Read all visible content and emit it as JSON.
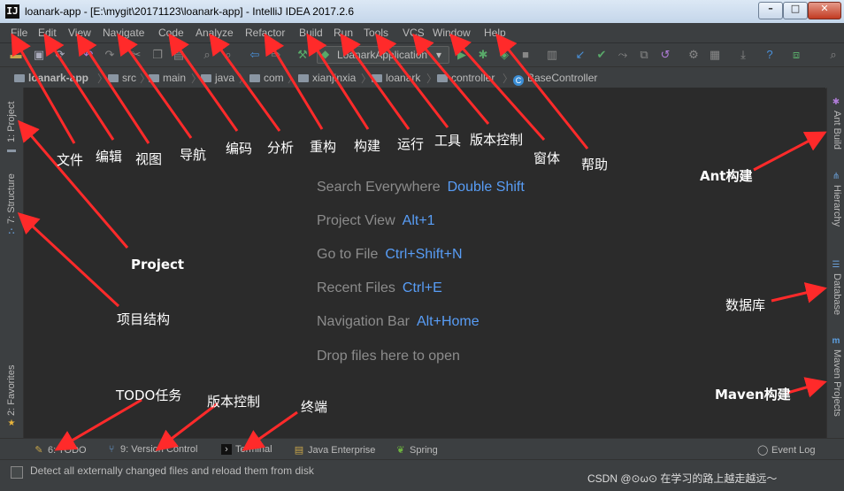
{
  "window": {
    "icon": "IJ",
    "title": "loanark-app - [E:\\mygit\\20171123\\loanark-app] - IntelliJ IDEA 2017.2.6",
    "min": "–",
    "max": "□",
    "close": "✕"
  },
  "menu": [
    "File",
    "Edit",
    "View",
    "Navigate",
    "Code",
    "Analyze",
    "Refactor",
    "Build",
    "Run",
    "Tools",
    "VCS",
    "Window",
    "Help"
  ],
  "toolbar": {
    "run_config": "LoanarkApplication"
  },
  "breadcrumb": [
    "loanark-app",
    "src",
    "main",
    "java",
    "com",
    "xianjinxia",
    "loanark",
    "controller",
    "BaseController"
  ],
  "left_tabs": {
    "project": "1: Project",
    "structure": "7: Structure",
    "favorites": "2: Favorites"
  },
  "right_tabs": {
    "ant": "Ant Build",
    "hierarchy": "Hierarchy",
    "database": "Database",
    "maven": "Maven Projects"
  },
  "hints": [
    {
      "label": "Search Everywhere",
      "key": "Double Shift"
    },
    {
      "label": "Project View",
      "key": "Alt+1"
    },
    {
      "label": "Go to File",
      "key": "Ctrl+Shift+N"
    },
    {
      "label": "Recent Files",
      "key": "Ctrl+E"
    },
    {
      "label": "Navigation Bar",
      "key": "Alt+Home"
    },
    {
      "label": "Drop files here to open",
      "key": ""
    }
  ],
  "bottom_tabs": [
    "6: TODO",
    "9: Version Control",
    "Terminal",
    "Java Enterprise",
    "Spring"
  ],
  "event_log": "Event Log",
  "status": {
    "message": "Detect all externally changed files and reload them from disk"
  },
  "watermark": "CSDN @⊙ω⊙ 在学习的路上越走越远～",
  "annotations": {
    "file": "文件",
    "edit": "编辑",
    "view": "视图",
    "navigate": "导航",
    "code": "编码",
    "analyze": "分析",
    "refactor": "重构",
    "build": "构建",
    "run": "运行",
    "tools": "工具",
    "vcs": "版本控制",
    "window": "窗体",
    "help": "帮助",
    "ant": "Ant构建",
    "project": "Project",
    "structure": "项目结构",
    "database": "数据库",
    "todo": "TODO任务",
    "vc": "版本控制",
    "terminal": "终端",
    "maven": "Maven构建"
  },
  "colors": {
    "arrow": "#ff2a2a",
    "hint_key": "#589df6",
    "background": "#2b2b2b"
  }
}
